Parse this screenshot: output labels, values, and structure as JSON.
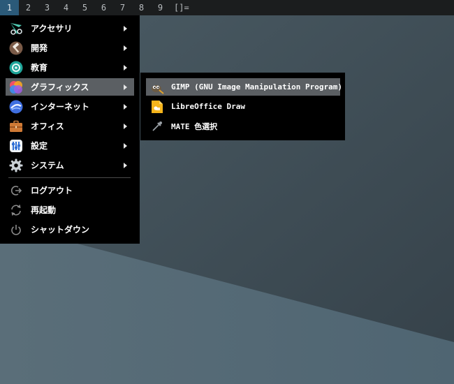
{
  "topbar": {
    "workspaces": [
      "1",
      "2",
      "3",
      "4",
      "5",
      "6",
      "7",
      "8",
      "9"
    ],
    "active_workspace": "1",
    "layout_indicator": "[]="
  },
  "menu": {
    "items": [
      {
        "label": "アクセサリ",
        "icon": "accessories-icon",
        "has_submenu": true
      },
      {
        "label": "開発",
        "icon": "hammer-icon",
        "has_submenu": true
      },
      {
        "label": "教育",
        "icon": "education-icon",
        "has_submenu": true
      },
      {
        "label": "グラフィックス",
        "icon": "graphics-icon",
        "has_submenu": true,
        "selected": true
      },
      {
        "label": "インターネット",
        "icon": "internet-icon",
        "has_submenu": true
      },
      {
        "label": "オフィス",
        "icon": "briefcase-icon",
        "has_submenu": true
      },
      {
        "label": "設定",
        "icon": "settings-icon",
        "has_submenu": true
      },
      {
        "label": "システム",
        "icon": "gear-icon",
        "has_submenu": true
      }
    ],
    "session": [
      {
        "label": "ログアウト",
        "icon": "logout-icon"
      },
      {
        "label": "再起動",
        "icon": "reboot-icon"
      },
      {
        "label": "シャットダウン",
        "icon": "power-icon"
      }
    ]
  },
  "submenu": {
    "items": [
      {
        "label": "GIMP (GNU Image Manipulation Program)",
        "icon": "gimp-icon",
        "selected": true
      },
      {
        "label": "LibreOffice Draw",
        "icon": "libreoffice-draw-icon"
      },
      {
        "label": "MATE 色選択",
        "icon": "color-picker-icon"
      }
    ]
  },
  "colors": {
    "menu_bg": "#000000",
    "selected_bg": "#5b5f63",
    "topbar_bg": "#1b1d1e",
    "active_workspace_bg": "#2b5a79",
    "wallpaper": "#3f4e56"
  }
}
